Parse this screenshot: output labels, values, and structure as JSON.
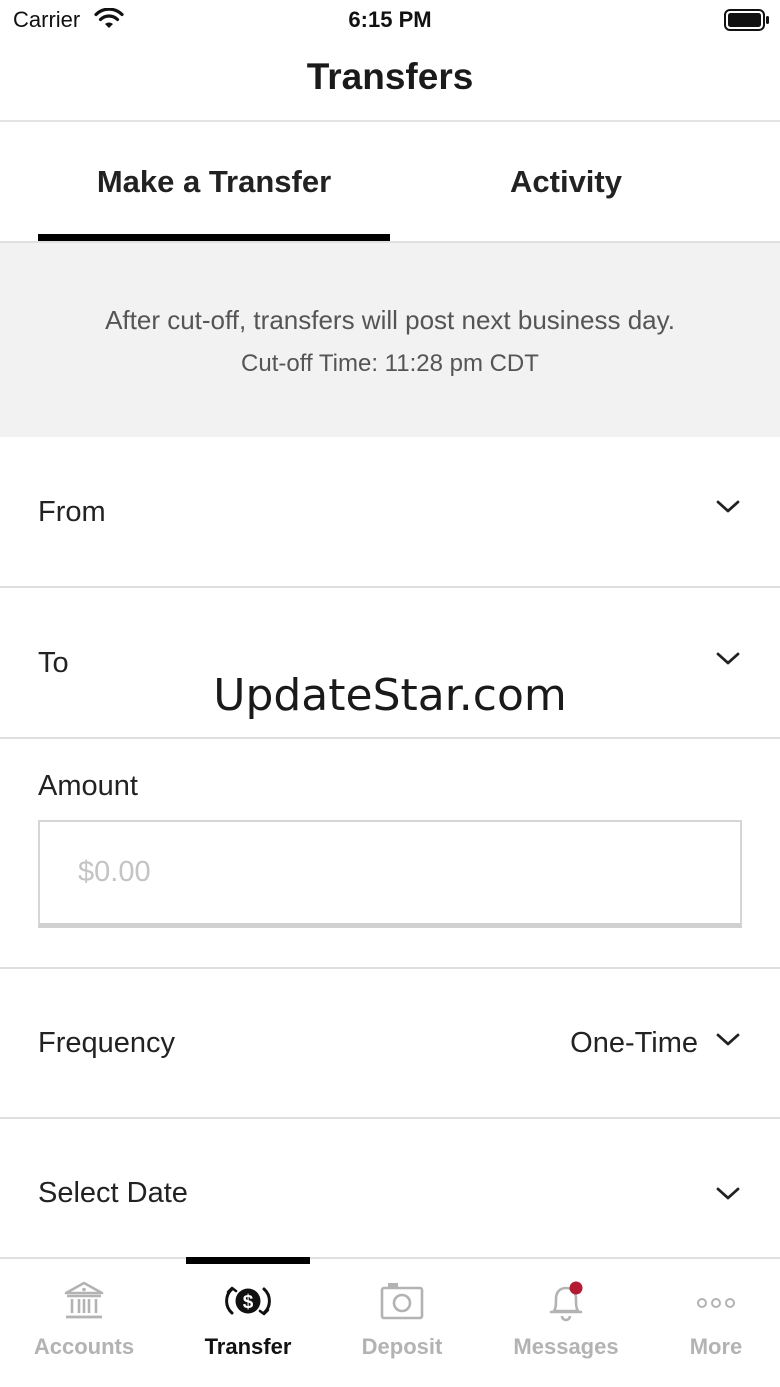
{
  "status_bar": {
    "carrier": "Carrier",
    "time": "6:15 PM"
  },
  "nav": {
    "title": "Transfers"
  },
  "tabs": [
    {
      "label": "Make a Transfer",
      "active": true
    },
    {
      "label": "Activity",
      "active": false
    }
  ],
  "banner": {
    "line1": "After cut-off, transfers will post next business day.",
    "line2": "Cut-off Time: 11:28 pm CDT"
  },
  "form": {
    "from_label": "From",
    "to_label": "To",
    "amount_label": "Amount",
    "amount_placeholder": "$0.00",
    "frequency_label": "Frequency",
    "frequency_value": "One-Time",
    "date_label": "Select Date"
  },
  "watermark": "UpdateStar.com",
  "tab_bar": {
    "items": [
      {
        "label": "Accounts",
        "icon": "bank-icon",
        "active": false
      },
      {
        "label": "Transfer",
        "icon": "transfer-dollar-icon",
        "active": true
      },
      {
        "label": "Deposit",
        "icon": "camera-icon",
        "active": false
      },
      {
        "label": "Messages",
        "icon": "bell-icon",
        "active": false,
        "badge": true
      },
      {
        "label": "More",
        "icon": "more-dots-icon",
        "active": false
      }
    ]
  },
  "colors": {
    "active": "#111111",
    "inactive": "#b3b3b3",
    "badge": "#b31b34",
    "banner_bg": "#f2f2f2"
  }
}
